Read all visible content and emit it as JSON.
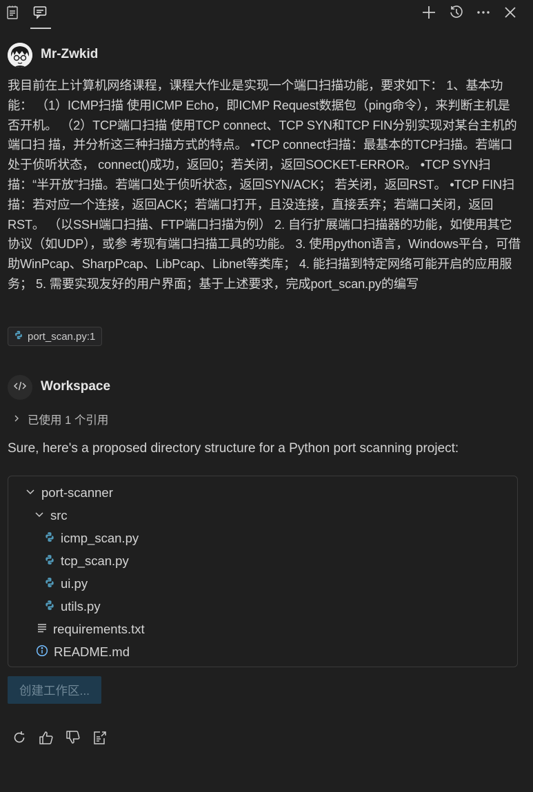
{
  "header": {
    "icons": [
      "notebook-icon",
      "chat-icon",
      "plus-icon",
      "history-icon",
      "more-icon",
      "close-icon"
    ]
  },
  "user": {
    "name": "Mr-Zwkid",
    "message": "我目前在上计算机网络课程，课程大作业是实现一个端口扫描功能，要求如下： 1、基本功能： （1）ICMP扫描 使用ICMP Echo，即ICMP Request数据包（ping命令），来判断主机是 否开机。 （2）TCP端口扫描 使用TCP connect、TCP SYN和TCP FIN分别实现对某台主机的端口扫 描，并分析这三种扫描方式的特点。 •TCP connect扫描：最基本的TCP扫描。若端口处于侦听状态， connect()成功，返回0；若关闭，返回SOCKET-ERROR。 •TCP SYN扫描：“半开放”扫描。若端口处于侦听状态，返回SYN/ACK； 若关闭，返回RST。 •TCP FIN扫描：若对应一个连接，返回ACK；若端口打开，且没连接，直接丢弃；若端口关闭，返回RST。 （以SSH端口扫描、FTP端口扫描为例） 2. 自行扩展端口扫描器的功能，如使用其它协议（如UDP），或参 考现有端口扫描工具的功能。 3. 使用python语言，Windows平台，可借助WinPcap、SharpPcap、LibPcap、Libnet等类库； 4. 能扫描到特定网络可能开启的应用服务； 5. 需要实现友好的用户界面；基于上述要求，完成port_scan.py的编写",
    "attachment": "port_scan.py:1"
  },
  "workspace": {
    "name": "Workspace",
    "references_label": "已使用 1 个引用",
    "answer": "Sure, here's a proposed directory structure for a Python port scanning project:",
    "tree": [
      {
        "label": "port-scanner",
        "type": "folder"
      },
      {
        "label": "src",
        "type": "folder"
      },
      {
        "label": "icmp_scan.py",
        "type": "python"
      },
      {
        "label": "tcp_scan.py",
        "type": "python"
      },
      {
        "label": "ui.py",
        "type": "python"
      },
      {
        "label": "utils.py",
        "type": "python"
      },
      {
        "label": "requirements.txt",
        "type": "text"
      },
      {
        "label": "README.md",
        "type": "info"
      }
    ],
    "create_button": "创建工作区..."
  },
  "actions": [
    "retry-icon",
    "thumbs-up-icon",
    "thumbs-down-icon",
    "insert-icon"
  ],
  "colors": {
    "background": "#1f1f1f",
    "python_icon": "#519aba",
    "info_icon": "#75beff",
    "button_bg": "#1e3a4d"
  }
}
